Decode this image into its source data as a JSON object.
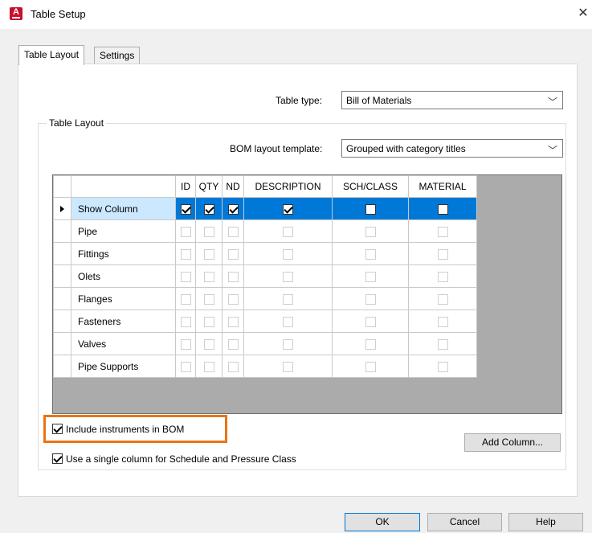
{
  "window": {
    "title": "Table Setup",
    "app_icon_letter": "A",
    "close_glyph": "✕"
  },
  "tabs": [
    {
      "label": "Table Layout",
      "active": true
    },
    {
      "label": "Settings",
      "active": false
    }
  ],
  "table_type": {
    "label": "Table type:",
    "value": "Bill of Materials"
  },
  "group": {
    "title": "Table Layout",
    "template_label": "BOM layout template:",
    "template_value": "Grouped with category titles"
  },
  "grid": {
    "columns": [
      "ID",
      "QTY",
      "ND",
      "DESCRIPTION",
      "SCH/CLASS",
      "MATERIAL"
    ],
    "rows": [
      {
        "name": "Show Column",
        "selected": true,
        "values": [
          true,
          true,
          true,
          true,
          false,
          false
        ]
      },
      {
        "name": "Pipe",
        "values": [
          false,
          false,
          false,
          false,
          false,
          false
        ]
      },
      {
        "name": "Fittings",
        "values": [
          false,
          false,
          false,
          false,
          false,
          false
        ]
      },
      {
        "name": "Olets",
        "values": [
          false,
          false,
          false,
          false,
          false,
          false
        ]
      },
      {
        "name": "Flanges",
        "values": [
          false,
          false,
          false,
          false,
          false,
          false
        ]
      },
      {
        "name": "Fasteners",
        "values": [
          false,
          false,
          false,
          false,
          false,
          false
        ]
      },
      {
        "name": "Valves",
        "values": [
          false,
          false,
          false,
          false,
          false,
          false
        ]
      },
      {
        "name": "Pipe Supports",
        "values": [
          false,
          false,
          false,
          false,
          false,
          false
        ]
      }
    ]
  },
  "options": {
    "include_instruments": {
      "label": "Include instruments in BOM",
      "checked": true
    },
    "single_column": {
      "label": "Use a single column for Schedule and Pressure Class",
      "checked": true
    }
  },
  "buttons": {
    "add_column": "Add Column...",
    "ok": "OK",
    "cancel": "Cancel",
    "help": "Help"
  },
  "colors": {
    "selection": "#0078d7",
    "highlight_box": "#e97316",
    "app_icon": "#c8102e"
  }
}
